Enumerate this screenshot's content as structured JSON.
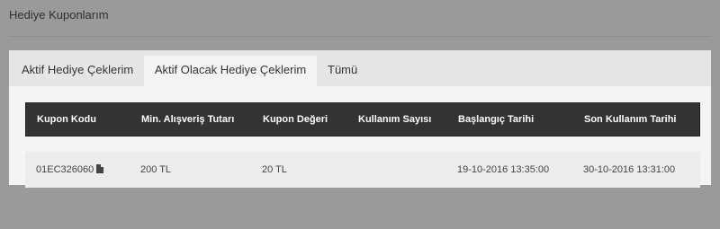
{
  "page": {
    "title": "Hediye Kuponlarım"
  },
  "tabs": [
    {
      "label": "Aktif Hediye Çeklerim",
      "active": false
    },
    {
      "label": "Aktif Olacak Hediye Çeklerim",
      "active": true
    },
    {
      "label": "Tümü",
      "active": false
    }
  ],
  "table": {
    "headers": [
      "Kupon Kodu",
      "Min. Alışveriş Tutarı",
      "Kupon Değeri",
      "Kullanım Sayısı",
      "Başlangıç Tarihi",
      "Son Kullanım Tarihi"
    ],
    "rows": [
      {
        "code": "01EC326060",
        "code_icon": "document-icon",
        "min_amount": "200 TL",
        "value": "20 TL",
        "usage_count": "",
        "start_date": "19-10-2016 13:35:00",
        "end_date": "30-10-2016 13:31:00"
      }
    ]
  },
  "colors": {
    "overlay": "#9a9a9a",
    "panel": "#f4f4f4",
    "tabs_bar": "#e6e6e6",
    "table_header": "#333333",
    "row": "#ececec"
  }
}
